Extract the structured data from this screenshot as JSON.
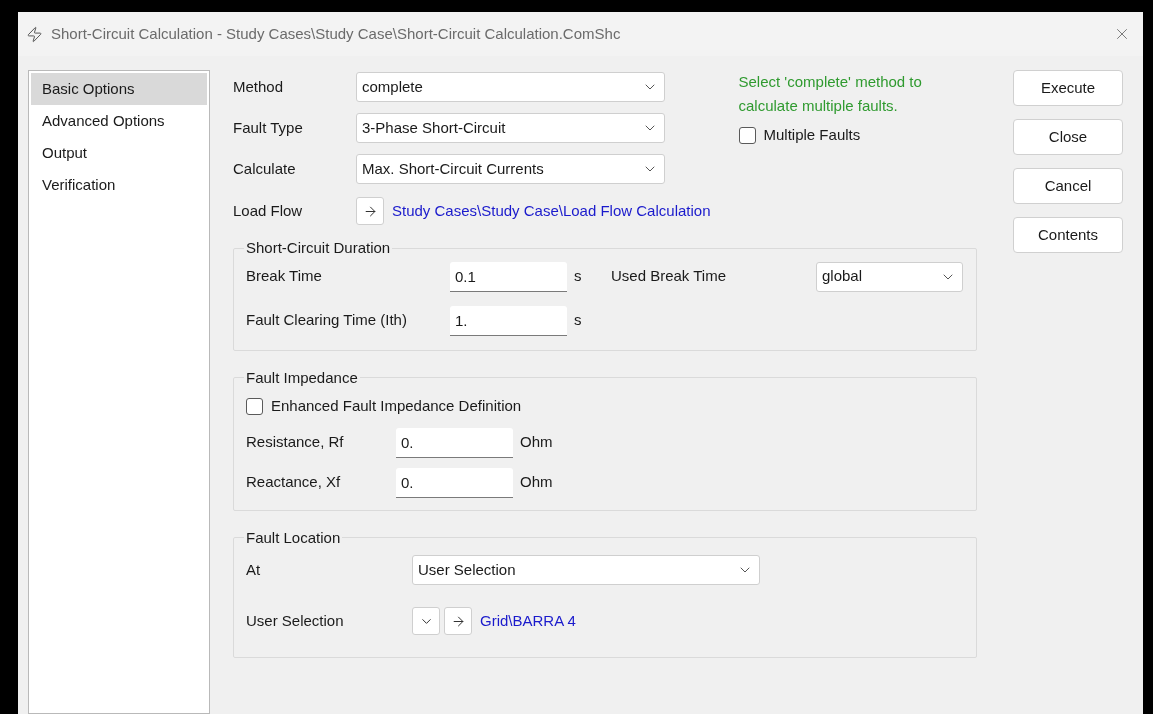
{
  "window": {
    "title": "Short-Circuit Calculation - Study Cases\\Study Case\\Short-Circuit Calculation.ComShc"
  },
  "sidebar": {
    "items": [
      {
        "label": "Basic Options",
        "selected": true
      },
      {
        "label": "Advanced Options",
        "selected": false
      },
      {
        "label": "Output",
        "selected": false
      },
      {
        "label": "Verification",
        "selected": false
      }
    ]
  },
  "settings": [
    {
      "label": "Method",
      "value": "complete"
    },
    {
      "label": "Fault Type",
      "value": "3-Phase Short-Circuit"
    },
    {
      "label": "Calculate",
      "value": "Max. Short-Circuit Currents"
    }
  ],
  "load_flow": {
    "label": "Load Flow",
    "link": "Study Cases\\Study Case\\Load Flow Calculation"
  },
  "hint": "Select 'complete' method to calculate multiple faults.",
  "multiple_faults": {
    "label": "Multiple Faults",
    "checked": false
  },
  "buttons": [
    "Execute",
    "Close",
    "Cancel",
    "Contents"
  ],
  "duration": {
    "title": "Short-Circuit Duration",
    "break_time": {
      "label": "Break Time",
      "value": "0.1",
      "unit": "s"
    },
    "used_break_time": {
      "label": "Used Break Time",
      "value": "global"
    },
    "clearing_time": {
      "label": "Fault Clearing Time (Ith)",
      "value": "1.",
      "unit": "s"
    }
  },
  "impedance": {
    "title": "Fault Impedance",
    "enhanced": {
      "label": "Enhanced Fault Impedance Definition",
      "checked": false
    },
    "fields": [
      {
        "label": "Resistance, Rf",
        "value": "0.",
        "unit": "Ohm"
      },
      {
        "label": "Reactance, Xf",
        "value": "0.",
        "unit": "Ohm"
      }
    ]
  },
  "location": {
    "title": "Fault Location",
    "at": {
      "label": "At",
      "value": "User Selection"
    },
    "user_selection": {
      "label": "User Selection",
      "link": "Grid\\BARRA 4"
    }
  }
}
